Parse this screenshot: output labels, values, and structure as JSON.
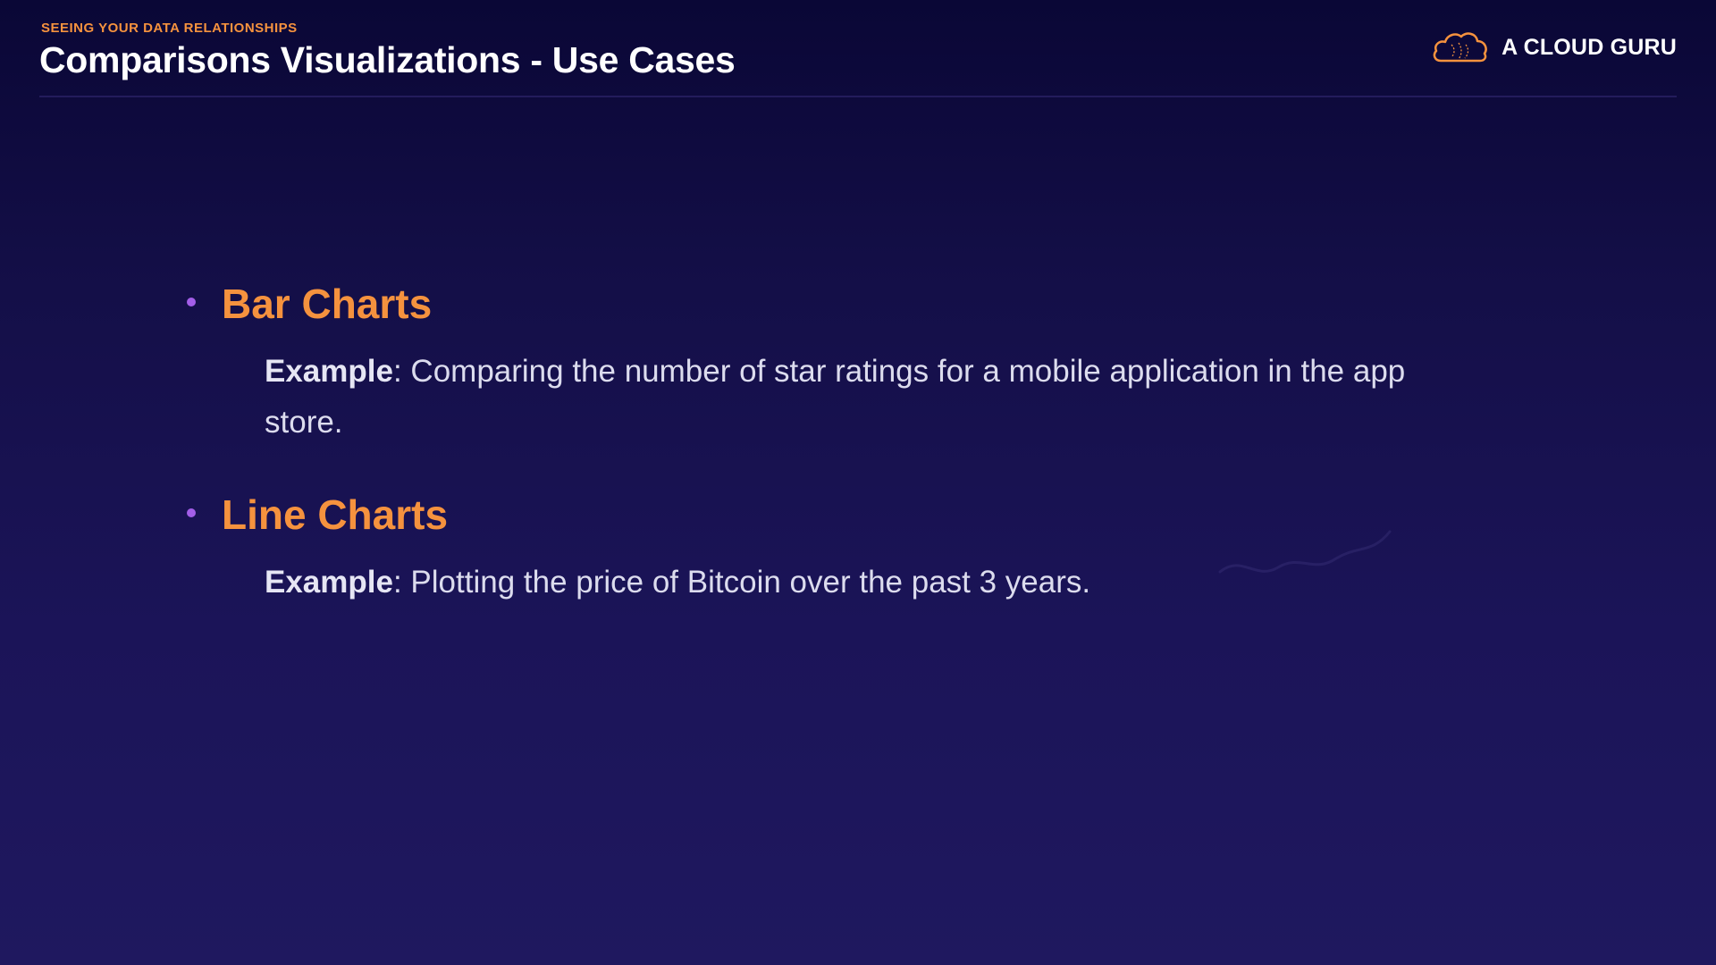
{
  "header": {
    "eyebrow": "SEEING YOUR DATA RELATIONSHIPS",
    "title": "Comparisons Visualizations - Use Cases",
    "brand": "A CLOUD GURU",
    "brand_icon": "cloud-logo-icon",
    "accent_color": "#f5923e"
  },
  "bullets": [
    {
      "heading": "Bar Charts",
      "example_label": "Example",
      "example_text": ": Comparing the number of star ratings for a mobile application in the app store."
    },
    {
      "heading": "Line Charts",
      "example_label": "Example",
      "example_text": ": Plotting the price of Bitcoin over the past 3 years."
    }
  ]
}
